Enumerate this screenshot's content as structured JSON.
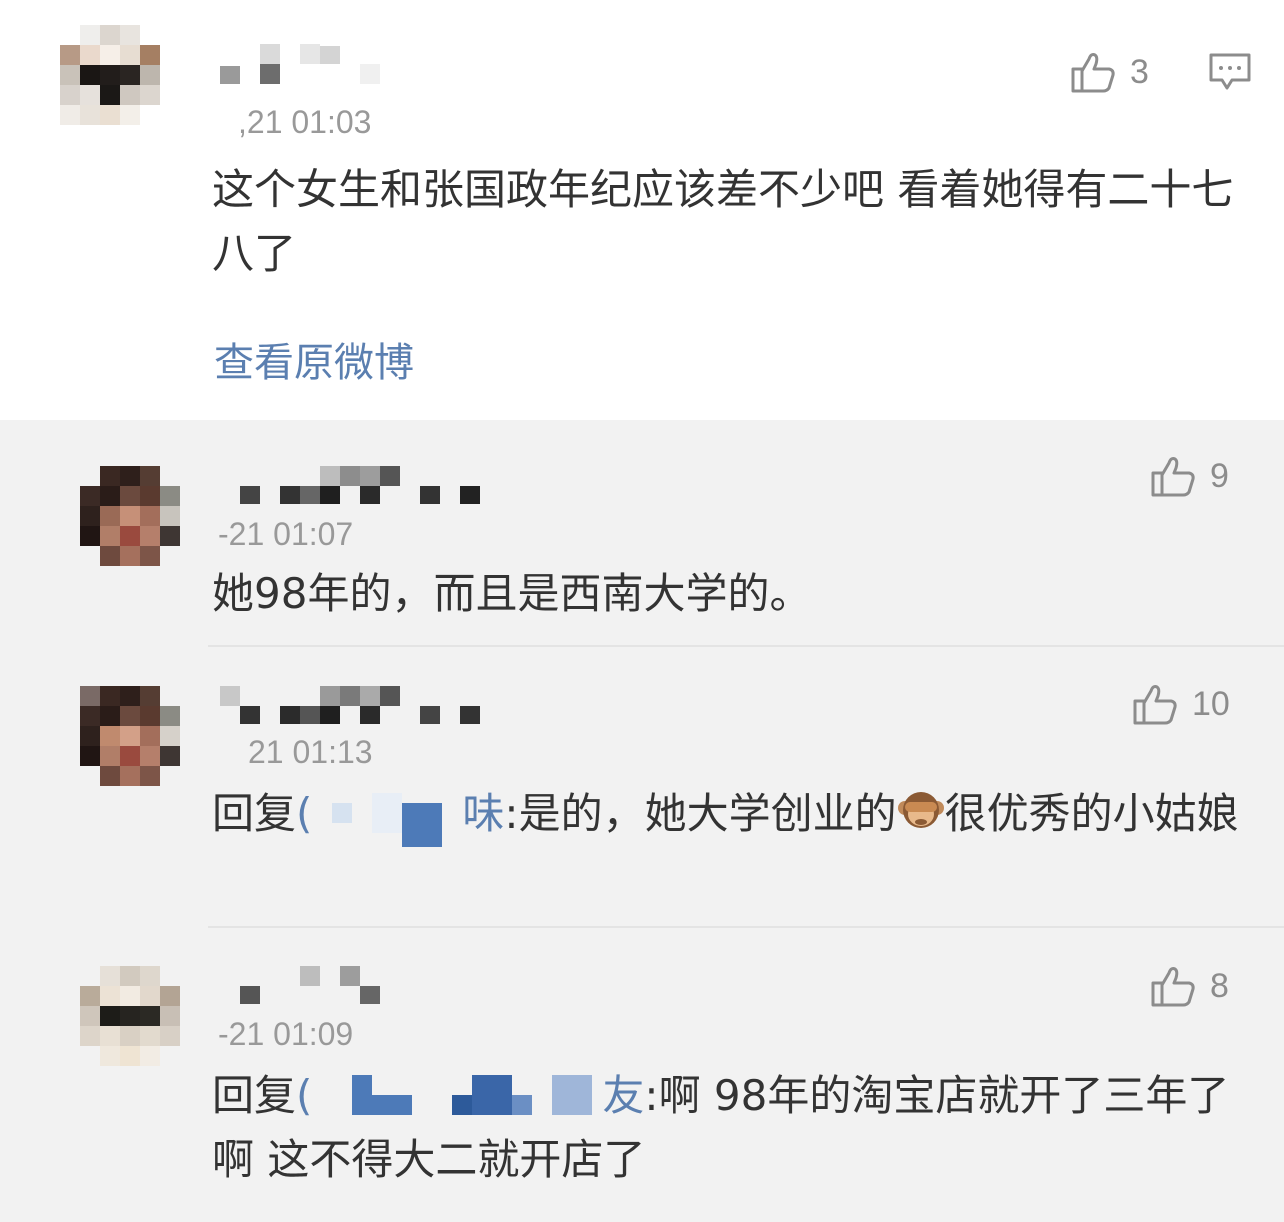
{
  "main_comment": {
    "time": "21 01:03",
    "time_prefix": ",",
    "content": "这个女生和张国政年纪应该差不少吧 看着她得有二十七八了",
    "likes": "3",
    "view_original_label": "查看原微博"
  },
  "replies": [
    {
      "time": "-21 01:07",
      "content": "她98年的，而且是西南大学的。",
      "likes": "9"
    },
    {
      "time": "21 01:13",
      "reply_prefix": "回复",
      "mention_open": "(",
      "mention_tail": "味",
      "content_after": ":是的，她大学创业的",
      "emoji": "see-no-evil-monkey",
      "content_tail": "很优秀的小姑娘",
      "likes": "10"
    },
    {
      "time": "-21 01:09",
      "reply_prefix": "回复",
      "mention_open": "(",
      "mention_tail": "友",
      "content_after": ":啊 98年的淘宝店就开了三年了啊 这不得大二就开店了",
      "likes": "8"
    }
  ],
  "colors": {
    "link": "#5b7fb0",
    "text": "#333333",
    "meta": "#999999",
    "icon": "#8c8c8c",
    "reply_bg": "#f2f2f2",
    "main_bg": "#ffffff"
  },
  "icons": {
    "like": "thumbs-up-icon",
    "comment": "comment-bubble-icon"
  }
}
